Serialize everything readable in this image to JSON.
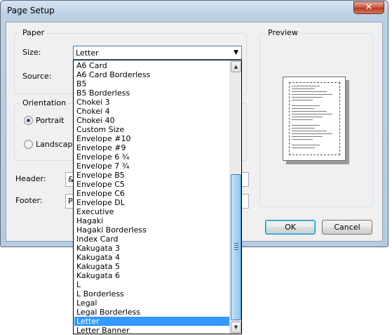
{
  "window": {
    "title": "Page Setup",
    "close_glyph": "✕"
  },
  "paper": {
    "group_label": "Paper",
    "size_label": "Size:",
    "size_value": "Letter",
    "source_label": "Source:"
  },
  "orientation": {
    "group_label": "Orientation",
    "portrait_label": "Portrait",
    "landscape_label": "Landscape",
    "selected": "Portrait"
  },
  "header": {
    "label": "Header:",
    "value_partial": "&f"
  },
  "footer": {
    "label": "Footer:",
    "value_partial": "Pa"
  },
  "preview": {
    "group_label": "Preview"
  },
  "buttons": {
    "ok": "OK",
    "cancel": "Cancel"
  },
  "dropdown": {
    "selected_index": 29,
    "items": [
      "A6 Card",
      "A6 Card Borderless",
      "B5",
      "B5 Borderless",
      "Chokei 3",
      "Chokei 4",
      "Chokei 40",
      "Custom Size",
      "Envelope #10",
      "Envelope #9",
      "Envelope 6 ¾",
      "Envelope 7 ¾",
      "Envelope B5",
      "Envelope C5",
      "Envelope C6",
      "Envelope DL",
      "Executive",
      "Hagaki",
      "Hagaki Borderless",
      "Index Card",
      "Kakugata 3",
      "Kakugata 4",
      "Kakugata 5",
      "Kakugata 6",
      "L",
      "L  Borderless",
      "Legal",
      "Legal Borderless",
      "Letter",
      "Letter Banner"
    ]
  },
  "icons": {
    "dropdown_arrow": "chevron-down-icon",
    "scroll_up": "scroll-up-icon",
    "scroll_down": "scroll-down-icon"
  },
  "colors": {
    "selection": "#3399ff",
    "window_frame": "#b5cbe2"
  }
}
